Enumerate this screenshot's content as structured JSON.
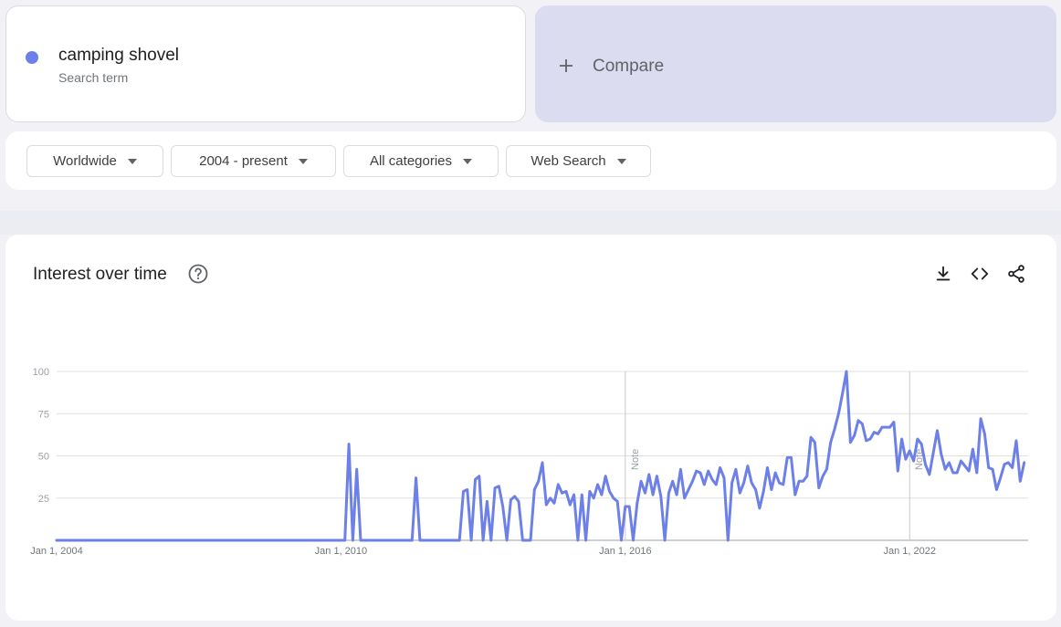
{
  "search_term": {
    "name": "camping shovel",
    "type_label": "Search term",
    "color": "#6d80e8"
  },
  "compare": {
    "icon": "plus-icon",
    "label": "Compare"
  },
  "filters": {
    "region": "Worldwide",
    "time_range": "2004 - present",
    "category": "All categories",
    "search_type": "Web Search"
  },
  "interest_panel": {
    "title": "Interest over time",
    "icons": [
      "help-icon",
      "download-icon",
      "embed-code-icon",
      "share-icon"
    ]
  },
  "chart_data": {
    "type": "line",
    "ylim": [
      0,
      100
    ],
    "yticks": [
      "100",
      "75",
      "50",
      "25"
    ],
    "xticks": [
      "Jan 1, 2004",
      "Jan 1, 2010",
      "Jan 1, 2016",
      "Jan 1, 2022"
    ],
    "annotations": [
      "Note",
      "Note"
    ],
    "grid": true,
    "series": [
      {
        "color": "#6d80e8",
        "points": [
          [
            "2004-01",
            0
          ],
          [
            "2010-02",
            0
          ],
          [
            "2010-03",
            57
          ],
          [
            "2010-04",
            0
          ],
          [
            "2010-05",
            42
          ],
          [
            "2010-06",
            0
          ],
          [
            "2011-07",
            0
          ],
          [
            "2011-08",
            37
          ],
          [
            "2011-09",
            0
          ],
          [
            "2012-07",
            0
          ],
          [
            "2012-08",
            29
          ],
          [
            "2012-09",
            30
          ],
          [
            "2012-10",
            0
          ],
          [
            "2012-11",
            36
          ],
          [
            "2012-12",
            38
          ],
          [
            "2013-01",
            0
          ],
          [
            "2013-02",
            23
          ],
          [
            "2013-03",
            0
          ],
          [
            "2013-04",
            31
          ],
          [
            "2013-05",
            32
          ],
          [
            "2013-06",
            20
          ],
          [
            "2013-07",
            0
          ],
          [
            "2013-08",
            24
          ],
          [
            "2013-09",
            26
          ],
          [
            "2013-10",
            23
          ],
          [
            "2013-11",
            0
          ],
          [
            "2014-01",
            0
          ],
          [
            "2014-02",
            30
          ],
          [
            "2014-03",
            35
          ],
          [
            "2014-04",
            46
          ],
          [
            "2014-05",
            21
          ],
          [
            "2014-06",
            25
          ],
          [
            "2014-07",
            22
          ],
          [
            "2014-08",
            33
          ],
          [
            "2014-09",
            28
          ],
          [
            "2014-10",
            29
          ],
          [
            "2014-11",
            21
          ],
          [
            "2014-12",
            27
          ],
          [
            "2015-01",
            0
          ],
          [
            "2015-02",
            27
          ],
          [
            "2015-03",
            0
          ],
          [
            "2015-04",
            29
          ],
          [
            "2015-05",
            25
          ],
          [
            "2015-06",
            33
          ],
          [
            "2015-07",
            27
          ],
          [
            "2015-08",
            38
          ],
          [
            "2015-09",
            29
          ],
          [
            "2015-10",
            25
          ],
          [
            "2015-11",
            23
          ],
          [
            "2015-12",
            0
          ],
          [
            "2016-01",
            20
          ],
          [
            "2016-02",
            20
          ],
          [
            "2016-03",
            0
          ],
          [
            "2016-04",
            22
          ],
          [
            "2016-05",
            35
          ],
          [
            "2016-06",
            28
          ],
          [
            "2016-07",
            39
          ],
          [
            "2016-08",
            27
          ],
          [
            "2016-09",
            38
          ],
          [
            "2016-10",
            26
          ],
          [
            "2016-11",
            0
          ],
          [
            "2016-12",
            28
          ],
          [
            "2017-01",
            35
          ],
          [
            "2017-02",
            27
          ],
          [
            "2017-03",
            42
          ],
          [
            "2017-04",
            25
          ],
          [
            "2017-05",
            30
          ],
          [
            "2017-06",
            35
          ],
          [
            "2017-07",
            41
          ],
          [
            "2017-08",
            40
          ],
          [
            "2017-09",
            33
          ],
          [
            "2017-10",
            41
          ],
          [
            "2017-11",
            36
          ],
          [
            "2017-12",
            33
          ],
          [
            "2018-01",
            43
          ],
          [
            "2018-02",
            37
          ],
          [
            "2018-03",
            0
          ],
          [
            "2018-04",
            34
          ],
          [
            "2018-05",
            42
          ],
          [
            "2018-06",
            28
          ],
          [
            "2018-07",
            34
          ],
          [
            "2018-08",
            44
          ],
          [
            "2018-09",
            34
          ],
          [
            "2018-10",
            30
          ],
          [
            "2018-11",
            19
          ],
          [
            "2018-12",
            29
          ],
          [
            "2019-01",
            43
          ],
          [
            "2019-02",
            30
          ],
          [
            "2019-03",
            40
          ],
          [
            "2019-04",
            34
          ],
          [
            "2019-05",
            33
          ],
          [
            "2019-06",
            49
          ],
          [
            "2019-07",
            49
          ],
          [
            "2019-08",
            27
          ],
          [
            "2019-09",
            35
          ],
          [
            "2019-10",
            35
          ],
          [
            "2019-11",
            38
          ],
          [
            "2019-12",
            61
          ],
          [
            "2020-01",
            58
          ],
          [
            "2020-02",
            31
          ],
          [
            "2020-03",
            38
          ],
          [
            "2020-04",
            42
          ],
          [
            "2020-05",
            58
          ],
          [
            "2020-06",
            66
          ],
          [
            "2020-07",
            75
          ],
          [
            "2020-08",
            87
          ],
          [
            "2020-09",
            100
          ],
          [
            "2020-10",
            58
          ],
          [
            "2020-11",
            62
          ],
          [
            "2020-12",
            71
          ],
          [
            "2021-01",
            69
          ],
          [
            "2021-02",
            59
          ],
          [
            "2021-03",
            60
          ],
          [
            "2021-04",
            64
          ],
          [
            "2021-05",
            63
          ],
          [
            "2021-06",
            67
          ],
          [
            "2021-07",
            67
          ],
          [
            "2021-08",
            67
          ],
          [
            "2021-09",
            70
          ],
          [
            "2021-10",
            41
          ],
          [
            "2021-11",
            60
          ],
          [
            "2021-12",
            48
          ],
          [
            "2022-01",
            53
          ],
          [
            "2022-02",
            47
          ],
          [
            "2022-03",
            60
          ],
          [
            "2022-04",
            57
          ],
          [
            "2022-05",
            45
          ],
          [
            "2022-06",
            39
          ],
          [
            "2022-07",
            52
          ],
          [
            "2022-08",
            65
          ],
          [
            "2022-09",
            51
          ],
          [
            "2022-10",
            42
          ],
          [
            "2022-11",
            46
          ],
          [
            "2022-12",
            40
          ],
          [
            "2023-01",
            40
          ],
          [
            "2023-02",
            47
          ],
          [
            "2023-03",
            44
          ],
          [
            "2023-04",
            41
          ],
          [
            "2023-05",
            54
          ],
          [
            "2023-06",
            40
          ],
          [
            "2023-07",
            72
          ],
          [
            "2023-08",
            63
          ],
          [
            "2023-09",
            43
          ],
          [
            "2023-10",
            42
          ],
          [
            "2023-11",
            30
          ],
          [
            "2023-12",
            37
          ],
          [
            "2024-01",
            45
          ],
          [
            "2024-02",
            46
          ],
          [
            "2024-03",
            43
          ],
          [
            "2024-04",
            59
          ],
          [
            "2024-05",
            35
          ],
          [
            "2024-06",
            46
          ]
        ]
      }
    ]
  }
}
